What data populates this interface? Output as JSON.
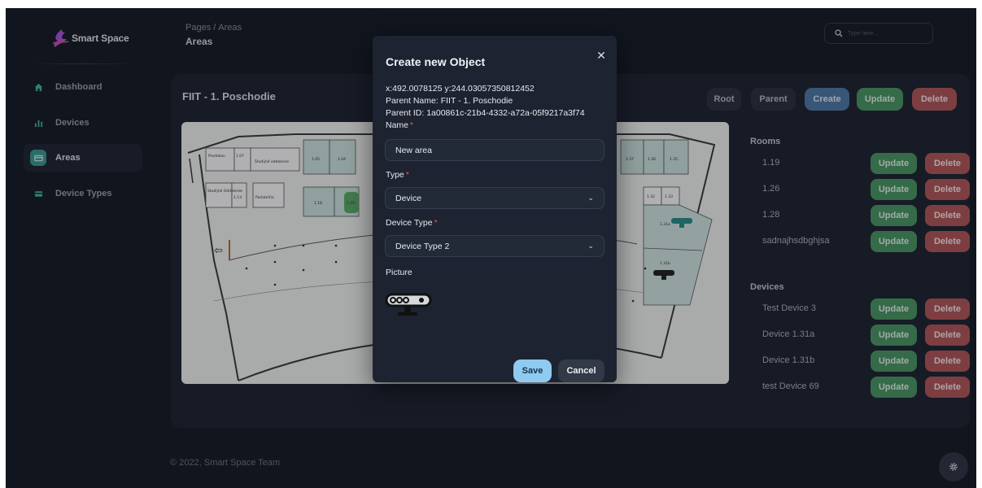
{
  "app": {
    "brand": "Smart Space"
  },
  "sidebar": {
    "items": [
      {
        "label": "Dashboard",
        "icon": "home-icon"
      },
      {
        "label": "Devices",
        "icon": "bar-chart-icon"
      },
      {
        "label": "Areas",
        "icon": "card-icon",
        "active": true
      },
      {
        "label": "Device Types",
        "icon": "card-icon"
      }
    ]
  },
  "header": {
    "breadcrumb": [
      "Pages",
      "Areas"
    ],
    "title": "Areas",
    "search_placeholder": "Type here..."
  },
  "area": {
    "title": "FIIT - 1. Poschodie",
    "buttons": {
      "root": "Root",
      "parent": "Parent",
      "create": "Create",
      "update": "Update",
      "delete": "Delete"
    }
  },
  "floorplan": {
    "labels": [
      "Prodekan",
      "1.07",
      "Študijné oddelenie",
      "1.05",
      "1.04",
      "1.37",
      "1.36",
      "1.35",
      "Studijné Oddelenie",
      "1.13",
      "Podateľňa",
      "1.18",
      "1.19",
      "1.32",
      "1.33",
      "1.31a",
      "1.31b"
    ]
  },
  "rooms": {
    "label": "Rooms",
    "items": [
      "1.19",
      "1.26",
      "1.28",
      "sadnajhsdbghjsa"
    ]
  },
  "devices": {
    "label": "Devices",
    "items": [
      "Test Device 3",
      "Device 1.31a",
      "Device 1.31b",
      "test Device 69"
    ]
  },
  "row_buttons": {
    "update": "Update",
    "delete": "Delete"
  },
  "footer": {
    "text": "© 2022, Smart Space Team"
  },
  "modal": {
    "title": "Create new Object",
    "coords": "x:492.0078125 y:244.03057350812452",
    "parent_name": "Parent Name: FIIT - 1. Poschodie",
    "parent_id": "Parent ID: 1a00861c-21b4-4332-a72a-05f9217a3f74",
    "name_label": "Name",
    "name_value": "New area",
    "type_label": "Type",
    "type_value": "Device",
    "device_type_label": "Device Type",
    "device_type_value": "Device Type 2",
    "picture_label": "Picture",
    "save": "Save",
    "cancel": "Cancel",
    "required_mark": "*"
  },
  "colors": {
    "background": "#161b25",
    "card": "#1e2431",
    "accent": "#3a9d93",
    "update": "#4a9a63",
    "delete": "#b4585b",
    "create": "#4e7ba8",
    "save": "#8fcaf0"
  }
}
